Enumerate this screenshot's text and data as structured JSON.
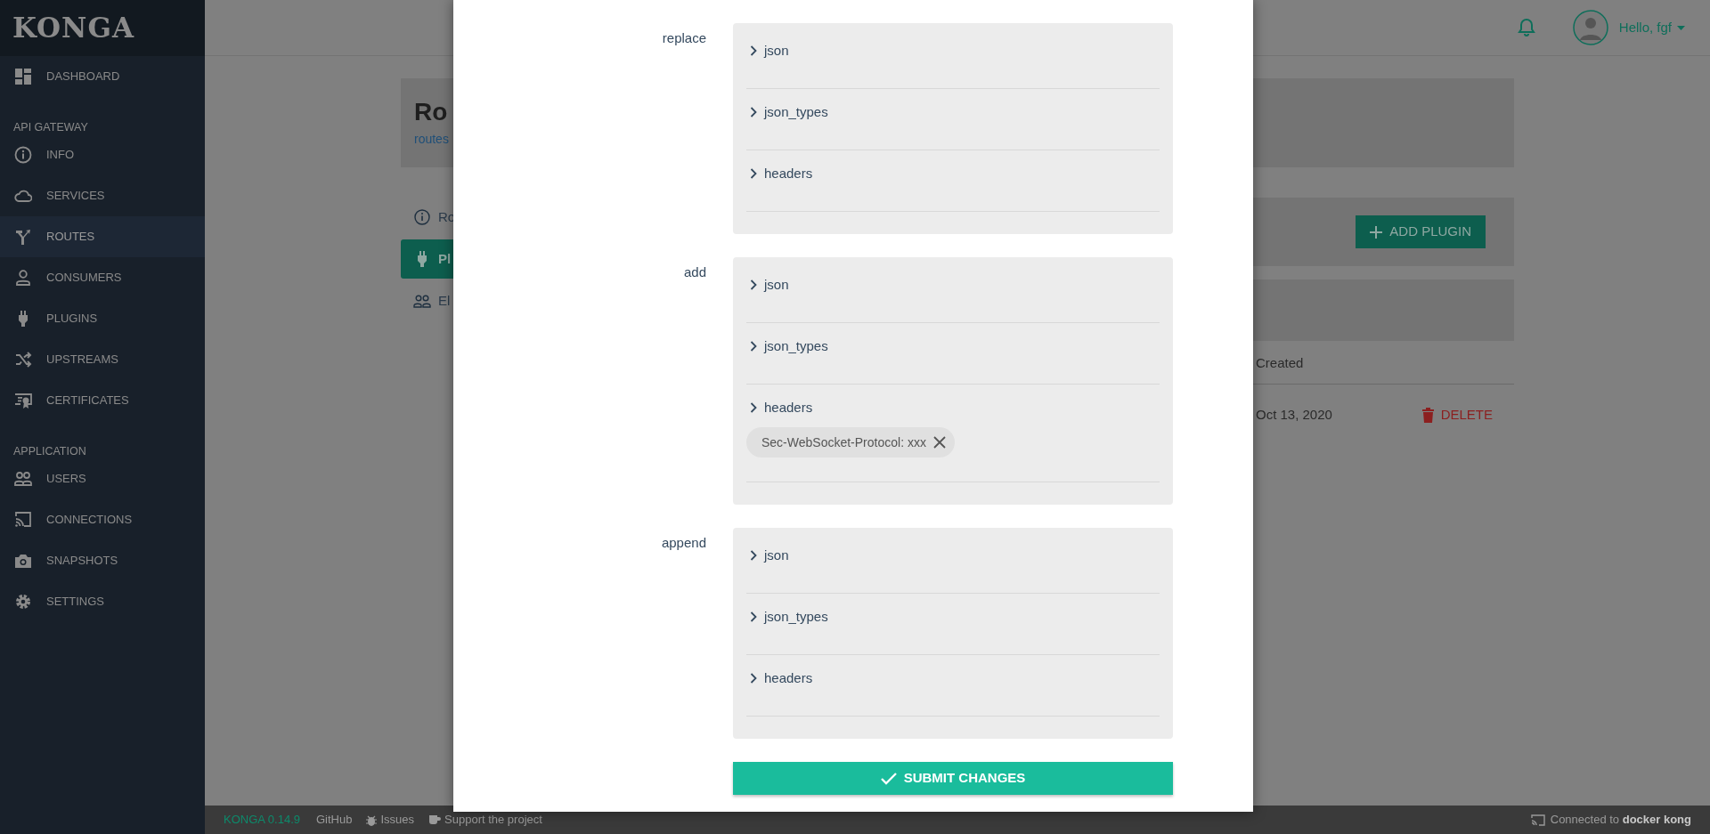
{
  "sidebar": {
    "logo": "KONGA",
    "items": [
      {
        "kind": "item",
        "label": "DASHBOARD",
        "selected": false
      },
      {
        "kind": "heading",
        "label": "API GATEWAY"
      },
      {
        "kind": "item",
        "label": "INFO",
        "selected": false
      },
      {
        "kind": "item",
        "label": "SERVICES",
        "selected": false
      },
      {
        "kind": "item",
        "label": "ROUTES",
        "selected": true
      },
      {
        "kind": "item",
        "label": "CONSUMERS",
        "selected": false
      },
      {
        "kind": "item",
        "label": "PLUGINS",
        "selected": false
      },
      {
        "kind": "item",
        "label": "UPSTREAMS",
        "selected": false
      },
      {
        "kind": "item",
        "label": "CERTIFICATES",
        "selected": false
      },
      {
        "kind": "heading",
        "label": "APPLICATION"
      },
      {
        "kind": "item",
        "label": "USERS",
        "selected": false
      },
      {
        "kind": "item",
        "label": "CONNECTIONS",
        "selected": false
      },
      {
        "kind": "item",
        "label": "SNAPSHOTS",
        "selected": false
      },
      {
        "kind": "item",
        "label": "SETTINGS",
        "selected": false
      }
    ]
  },
  "header": {
    "greeting": "Hello, fgf"
  },
  "page": {
    "title": "Ro",
    "breadcrumb": "routes",
    "tabs": [
      {
        "label": "Ro",
        "selected": false
      },
      {
        "label": "Pl",
        "selected": true
      },
      {
        "label": "El",
        "selected": false
      }
    ],
    "add_button": "ADD PLUGIN",
    "table": {
      "columns": [
        "Created"
      ],
      "rows": [
        {
          "created": "Oct 13, 2020",
          "action": "DELETE"
        }
      ]
    }
  },
  "modal": {
    "sections": [
      {
        "label": "replace",
        "fields": [
          {
            "label": "json",
            "expanded": false
          },
          {
            "label": "json_types",
            "expanded": false
          },
          {
            "label": "headers",
            "expanded": false
          }
        ]
      },
      {
        "label": "add",
        "fields": [
          {
            "label": "json",
            "expanded": false
          },
          {
            "label": "json_types",
            "expanded": false
          },
          {
            "label": "headers",
            "expanded": false,
            "tags": [
              "Sec-WebSocket-Protocol: xxx"
            ]
          }
        ]
      },
      {
        "label": "append",
        "fields": [
          {
            "label": "json",
            "expanded": false
          },
          {
            "label": "json_types",
            "expanded": false
          },
          {
            "label": "headers",
            "expanded": false
          }
        ]
      }
    ],
    "submit": "SUBMIT CHANGES"
  },
  "footer": {
    "version": "KONGA 0.14.9",
    "links": [
      "GitHub",
      "Issues",
      "Support the project"
    ],
    "connection_prefix": "Connected to",
    "connection_target": "docker kong"
  }
}
